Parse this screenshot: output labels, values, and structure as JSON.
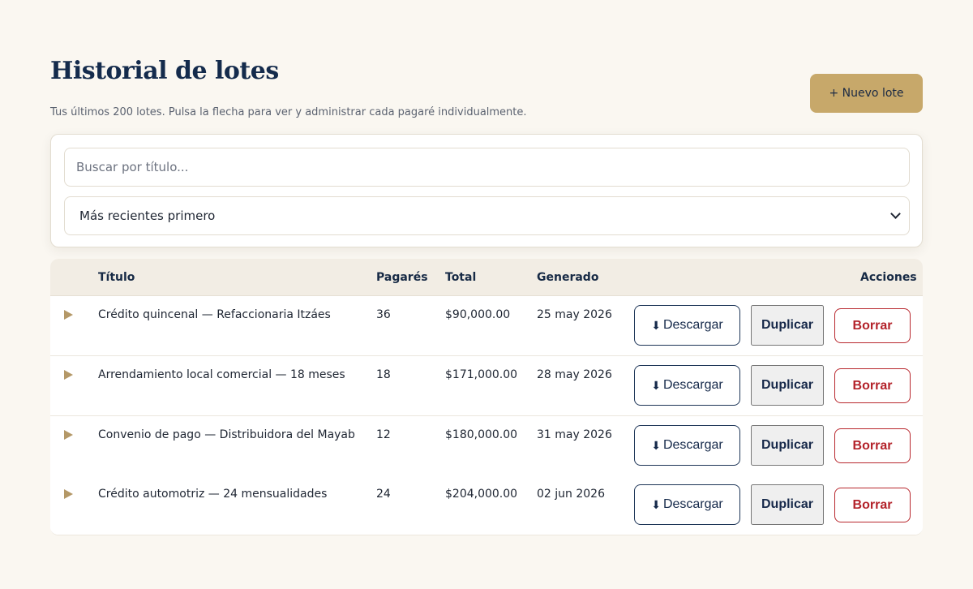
{
  "header": {
    "title": "Historial de lotes",
    "subtitle": "Tus últimos 200 lotes. Pulsa la flecha para ver y administrar cada pagaré individualmente.",
    "new_button_label": "+ Nuevo lote"
  },
  "filters": {
    "search_placeholder": "Buscar por título...",
    "sort_selected": "Más recientes primero"
  },
  "table": {
    "columns": {
      "title": "Título",
      "notes": "Pagarés",
      "total": "Total",
      "generated": "Generado",
      "actions": "Acciones"
    },
    "action_labels": {
      "download_icon": "⬇",
      "download": "Descargar",
      "duplicate": "Duplicar",
      "delete": "Borrar"
    },
    "rows": [
      {
        "title": "Crédito quincenal — Refaccionaria Itzáes",
        "notes": "36",
        "total": "$90,000.00",
        "generated": "25 may 2026"
      },
      {
        "title": "Arrendamiento local comercial — 18 meses",
        "notes": "18",
        "total": "$171,000.00",
        "generated": "28 may 2026"
      },
      {
        "title": "Convenio de pago — Distribuidora del Mayab",
        "notes": "12",
        "total": "$180,000.00",
        "generated": "31 may 2026"
      },
      {
        "title": "Crédito automotriz — 24 mensualidades",
        "notes": "24",
        "total": "$204,000.00",
        "generated": "02 jun 2026"
      }
    ]
  },
  "colors": {
    "background": "#faf7f1",
    "accent": "#c7a86a",
    "navy": "#142b4c",
    "danger": "#b3222a"
  }
}
